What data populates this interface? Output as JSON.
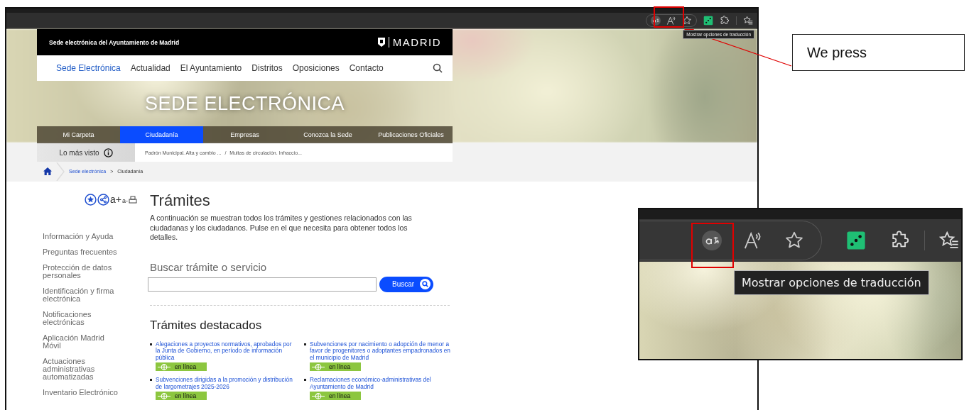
{
  "browser": {
    "tooltip": "Mostrar opciones de traducción"
  },
  "site": {
    "top_bar": {
      "title": "Sede electrónica del Ayuntamiento de Madrid",
      "logo": "MADRID"
    },
    "nav": [
      {
        "label": "Sede Electrónica",
        "selected": true
      },
      {
        "label": "Actualidad",
        "selected": false
      },
      {
        "label": "El Ayuntamiento",
        "selected": false
      },
      {
        "label": "Distritos",
        "selected": false
      },
      {
        "label": "Oposiciones",
        "selected": false
      },
      {
        "label": "Contacto",
        "selected": false
      }
    ],
    "banner_title": "SEDE ELECTRÓNICA",
    "sections": [
      {
        "label": "Mi Carpeta",
        "selected": false
      },
      {
        "label": "Ciudadanía",
        "selected": true
      },
      {
        "label": "Empresas",
        "selected": false
      },
      {
        "label": "Conozca la Sede",
        "selected": false
      },
      {
        "label": "Publicaciones Oficiales",
        "selected": false
      }
    ],
    "most_viewed": {
      "label": "Lo más visto",
      "links": [
        "Padrón Municipal. Alta y cambio ...",
        "Multas de circulación. Infraccio..."
      ],
      "separator": "/"
    },
    "breadcrumb": {
      "items": [
        "Sede electrónica",
        "Ciudadanía"
      ],
      "separator": ">"
    },
    "tools": {
      "font_up": "a+",
      "font_down": "a-"
    },
    "sidebar": [
      "Información y Ayuda",
      "Preguntas frecuentes",
      "Protección de datos personales",
      "Identificación y firma electrónica",
      "Notificaciones electrónicas",
      "Aplicación Madrid Móvil",
      "Actuaciones administrativas automatizadas",
      "Inventario Electrónico"
    ],
    "heading": "Trámites",
    "intro": "A continuación se muestran todos los trámites y gestiones relacionados con las ciudadanas y los ciudadanos. Pulse en el que necesita para obtener todos los detalles.",
    "search": {
      "label": "Buscar trámite o servicio",
      "button": "Buscar"
    },
    "featured": {
      "title": "Trámites destacados",
      "items": [
        {
          "title": "Alegaciones a proyectos normativos, aprobados por la Junta de Gobierno, en período de información pública",
          "badge": "en línea"
        },
        {
          "title": "Subvenciones por nacimiento o adopción de menor a favor de progenitores o adoptantes empadronados en el municipio de Madrid",
          "badge": "en línea"
        },
        {
          "title": "Subvenciones dirigidas a la promoción y distribución de largometrajes 2025-2026",
          "badge": "en línea"
        },
        {
          "title": "Reclamaciones económico-administrativas del Ayuntamiento de Madrid",
          "badge": "en línea"
        }
      ]
    }
  },
  "annotation": {
    "callout": "We press",
    "inset_tooltip": "Mostrar opciones de traducción"
  }
}
